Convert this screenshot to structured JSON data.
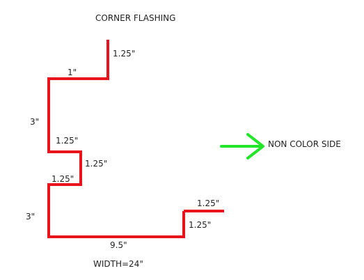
{
  "title": "CORNER FLASHING",
  "width_label": "WIDTH=24\"",
  "side_label": "NON COLOR SIDE",
  "colors": {
    "profile": "#e8141b",
    "arrow": "#22e62a",
    "text": "#222222"
  },
  "dimensions": {
    "top_flange": "1.25\"",
    "top_step": "1\"",
    "upper_vertical": "3\"",
    "mid_step_top": "1.25\"",
    "mid_vertical": "1.25\"",
    "mid_step_bottom": "1.25\"",
    "lower_vertical": "3\"",
    "bottom_run": "9.5\"",
    "end_hem_vertical": "1.25\"",
    "end_hem_horizontal": "1.25\""
  }
}
